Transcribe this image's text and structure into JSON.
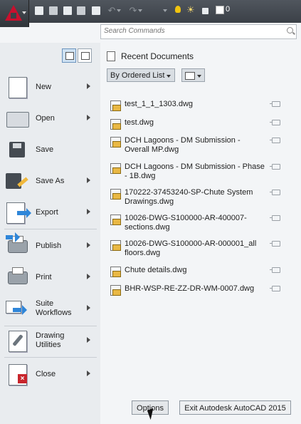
{
  "quick_access": {
    "icons": [
      "new-icon",
      "open-icon",
      "save-icon",
      "save-as-icon",
      "plot-icon",
      "undo-icon",
      "redo-icon",
      "customize-dropdown-icon"
    ],
    "layer_status_icons": [
      "lightbulb-icon",
      "sun-icon",
      "lock-icon",
      "layer-color-swatch"
    ],
    "layer_name": "0"
  },
  "search": {
    "placeholder": "Search Commands"
  },
  "left_menu": {
    "view_toggle": [
      "recent-documents-icon",
      "open-documents-icon"
    ],
    "items": [
      {
        "label": "New",
        "icon": "new-document-icon",
        "has_submenu": true
      },
      {
        "label": "Open",
        "icon": "folder-icon",
        "has_submenu": true
      },
      {
        "label": "Save",
        "icon": "floppy-disk-icon",
        "has_submenu": false
      },
      {
        "label": "Save As",
        "icon": "save-as-icon",
        "has_submenu": true
      },
      {
        "label": "Export",
        "icon": "export-icon",
        "has_submenu": true
      },
      {
        "label": "Publish",
        "icon": "publish-icon",
        "has_submenu": true
      },
      {
        "label": "Print",
        "icon": "printer-icon",
        "has_submenu": true
      },
      {
        "label": "Suite Workflows",
        "icon": "suite-workflows-icon",
        "has_submenu": true
      },
      {
        "label": "Drawing Utilities",
        "icon": "drawing-utilities-icon",
        "has_submenu": true
      },
      {
        "label": "Close",
        "icon": "close-document-icon",
        "has_submenu": true
      }
    ]
  },
  "recent": {
    "title": "Recent Documents",
    "order_by": "By Ordered List",
    "files": [
      "test_1_1_1303.dwg",
      "test.dwg",
      "DCH Lagoons - DM Submission - Overall MP.dwg",
      "DCH Lagoons - DM Submission - Phase - 1B.dwg",
      "170222-37453240-SP-Chute System Drawings.dwg",
      "10026-DWG-S100000-AR-400007-sections.dwg",
      "10026-DWG-S100000-AR-000001_all floors.dwg",
      "Chute details.dwg",
      "BHR-WSP-RE-ZZ-DR-WM-0007.dwg"
    ]
  },
  "footer": {
    "options_label": "Options",
    "exit_label": "Exit Autodesk AutoCAD 2015"
  }
}
